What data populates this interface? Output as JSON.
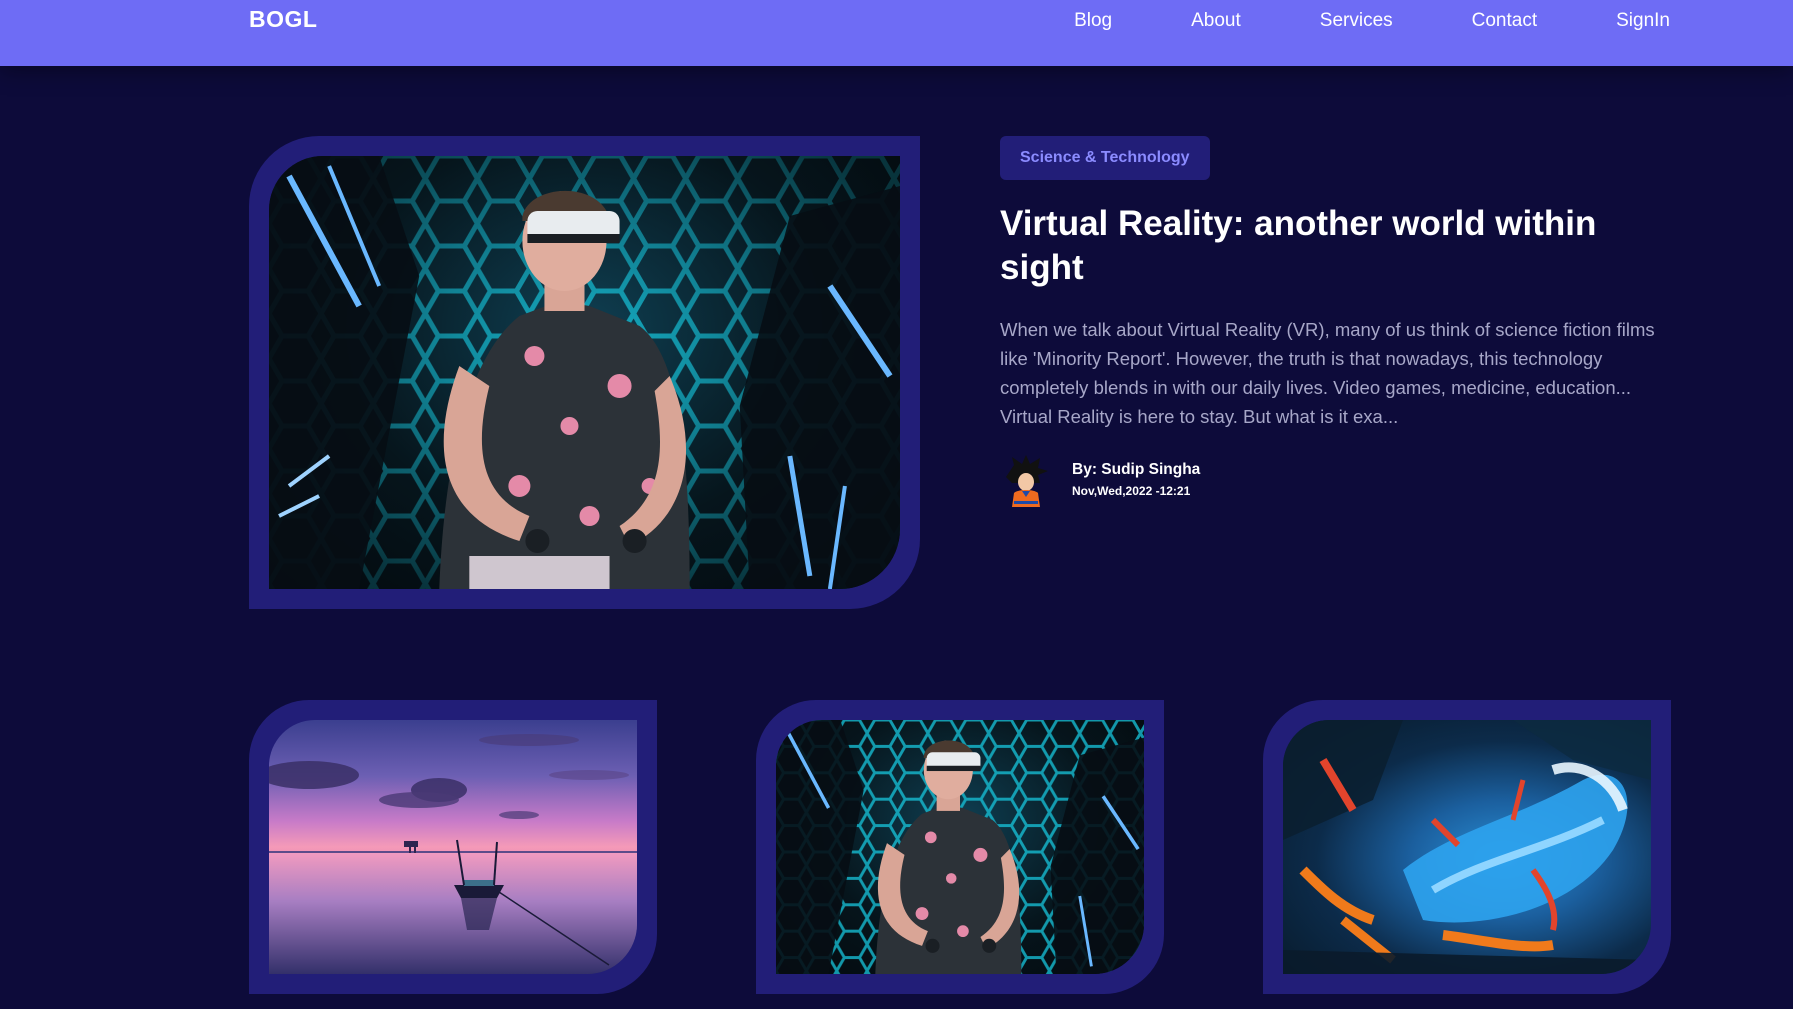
{
  "nav": {
    "brand": "BOGL",
    "links": [
      "Blog",
      "About",
      "Services",
      "Contact",
      "SignIn"
    ]
  },
  "featured": {
    "category": "Science & Technology",
    "title": "Virtual Reality: another world within sight",
    "excerpt": "When we talk about Virtual Reality (VR), many of us think of science fiction films like 'Minority Report'. However, the truth is that nowadays, this technology completely blends in with our daily lives. Video games, medicine, education... Virtual Reality is here to stay. But what is it exa...",
    "author": "By: Sudip Singha",
    "date": "Nov,Wed,2022 -12:21",
    "image": "vr-headset-photo"
  },
  "cards": [
    {
      "image": "sunset-boat-photo"
    },
    {
      "image": "vr-headset-photo"
    },
    {
      "image": "abstract-paint-photo"
    }
  ],
  "colors": {
    "background": "#0d0b3a",
    "navbar": "#6e6cf5",
    "frame": "#221e78",
    "badge_text": "#8b8bff",
    "excerpt_text": "#a7a7c8"
  }
}
